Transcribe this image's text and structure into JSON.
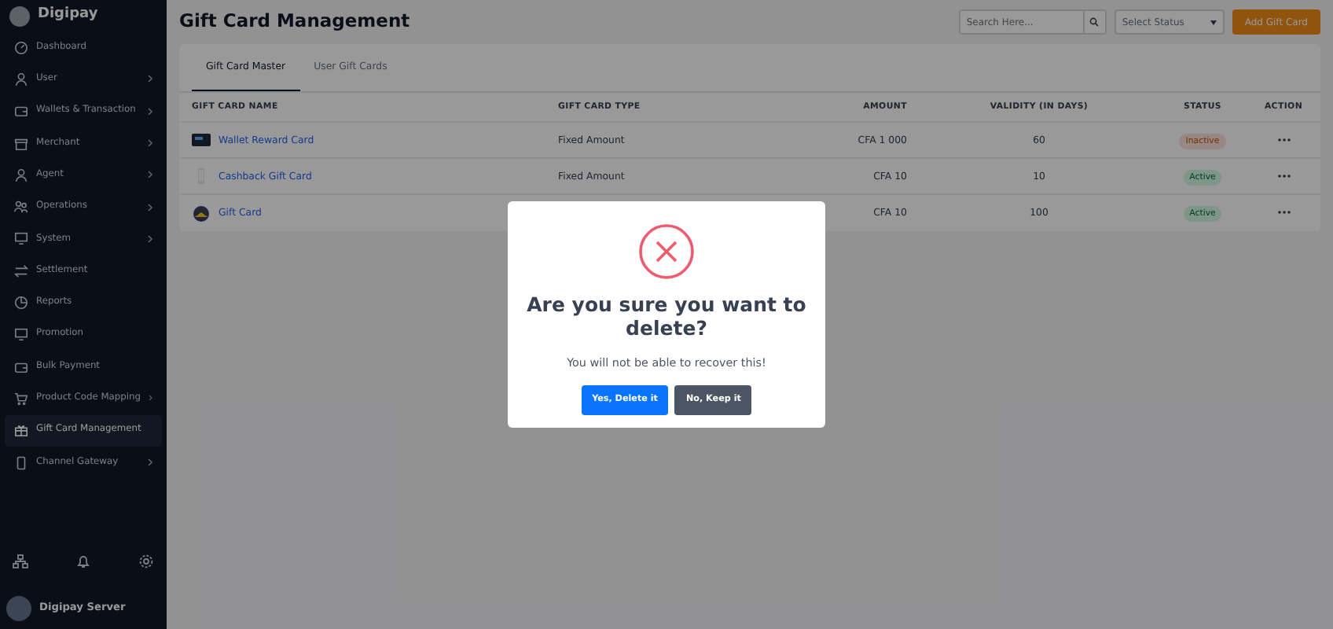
{
  "brand": "Digipay",
  "sidebar": {
    "items": [
      {
        "label": "Dashboard",
        "expandable": false,
        "selected": false
      },
      {
        "label": "User",
        "expandable": true,
        "selected": false
      },
      {
        "label": "Wallets & Transaction",
        "expandable": true,
        "selected": false
      },
      {
        "label": "Merchant",
        "expandable": true,
        "selected": false
      },
      {
        "label": "Agent",
        "expandable": true,
        "selected": false
      },
      {
        "label": "Operations",
        "expandable": true,
        "selected": false
      },
      {
        "label": "System",
        "expandable": true,
        "selected": false
      },
      {
        "label": "Settlement",
        "expandable": false,
        "selected": false
      },
      {
        "label": "Reports",
        "expandable": false,
        "selected": false
      },
      {
        "label": "Promotion",
        "expandable": false,
        "selected": false
      },
      {
        "label": "Bulk Payment",
        "expandable": false,
        "selected": false
      },
      {
        "label": "Product Code Mapping",
        "expandable": true,
        "selected": false
      },
      {
        "label": "Gift Card Management",
        "expandable": false,
        "selected": true
      },
      {
        "label": "Channel Gateway",
        "expandable": true,
        "selected": false
      }
    ],
    "user": "Digipay Server"
  },
  "page_title": "Gift Card Management",
  "search": {
    "placeholder": "Search Here..."
  },
  "status_select": {
    "placeholder": "Select Status"
  },
  "add_button": "Add Gift Card",
  "tabs": [
    {
      "label": "Gift Card Master",
      "selected": true
    },
    {
      "label": "User Gift Cards",
      "selected": false
    }
  ],
  "table": {
    "columns": [
      "GIFT CARD NAME",
      "GIFT CARD TYPE",
      "AMOUNT",
      "VALIDITY (IN DAYS)",
      "STATUS",
      "ACTION"
    ],
    "rows": [
      {
        "name": "Wallet Reward Card",
        "type": "Fixed Amount",
        "amount": "CFA 1 000",
        "validity": "60",
        "status": "Inactive",
        "active": false
      },
      {
        "name": "Cashback Gift Card",
        "type": "Fixed Amount",
        "amount": "CFA 10",
        "validity": "10",
        "status": "Active",
        "active": true
      },
      {
        "name": "Gift Card",
        "amount": "CFA 10",
        "validity": "100",
        "status": "Active",
        "active": true
      }
    ]
  },
  "dialog": {
    "title": "Are you sure you want to delete?",
    "message": "You will not be able to recover this!",
    "confirm": "Yes, Delete it",
    "cancel": "No, Keep it"
  }
}
